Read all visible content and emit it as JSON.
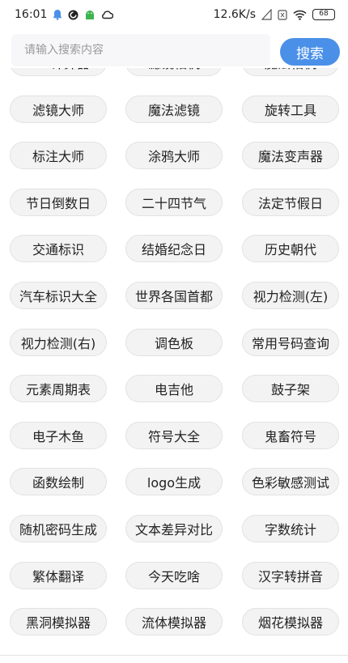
{
  "status_bar": {
    "time": "16:01",
    "network_speed": "12.6K/s",
    "battery": "68",
    "left_icons": [
      "bell-icon",
      "sync-app-icon",
      "android-icon",
      "cloud-icon"
    ],
    "right_icons": [
      "no-sim-icon",
      "sim-card-icon",
      "wifi-icon",
      "battery-icon"
    ]
  },
  "search": {
    "placeholder": "请输入搜索内容",
    "button_label": "搜索",
    "accent_color": "#4a90e8"
  },
  "tools": [
    [
      "BMI计算器",
      "滤镜相机",
      "魔法相机"
    ],
    [
      "滤镜大师",
      "魔法滤镜",
      "旋转工具"
    ],
    [
      "标注大师",
      "涂鸦大师",
      "魔法变声器"
    ],
    [
      "节日倒数日",
      "二十四节气",
      "法定节假日"
    ],
    [
      "交通标识",
      "结婚纪念日",
      "历史朝代"
    ],
    [
      "汽车标识大全",
      "世界各国首都",
      "视力检测(左)"
    ],
    [
      "视力检测(右)",
      "调色板",
      "常用号码查询"
    ],
    [
      "元素周期表",
      "电吉他",
      "鼓子架"
    ],
    [
      "电子木鱼",
      "符号大全",
      "鬼畜符号"
    ],
    [
      "函数绘制",
      "logo生成",
      "色彩敏感测试"
    ],
    [
      "随机密码生成",
      "文本差异对比",
      "字数统计"
    ],
    [
      "繁体翻译",
      "今天吃啥",
      "汉字转拼音"
    ],
    [
      "黑洞模拟器",
      "流体模拟器",
      "烟花模拟器"
    ]
  ],
  "bottom_nav": {
    "icons": [
      "home-icon",
      "discover-icon",
      "profile-icon"
    ]
  }
}
